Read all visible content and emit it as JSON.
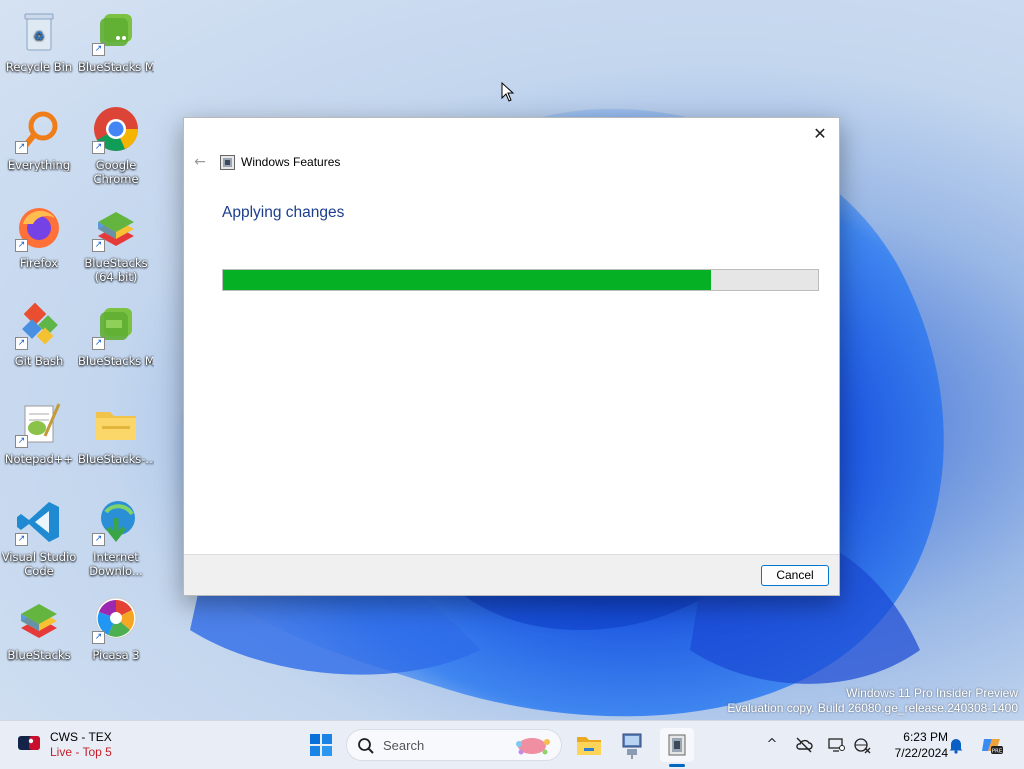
{
  "desktop": {
    "icons": [
      {
        "label": "Recycle Bin",
        "icon": "recycle-bin-icon"
      },
      {
        "label": "BlueStacks Multi-Insta...",
        "icon": "bluestacks-multi-instance-icon"
      },
      {
        "label": "Everything",
        "icon": "everything-search-icon"
      },
      {
        "label": "Google Chrome",
        "icon": "chrome-icon"
      },
      {
        "label": "Firefox",
        "icon": "firefox-icon"
      },
      {
        "label": "BlueStacks (64-bit)",
        "icon": "bluestacks-icon"
      },
      {
        "label": "Git Bash",
        "icon": "git-bash-icon"
      },
      {
        "label": "BlueStacks Multi-Insta...",
        "icon": "bluestacks-multi-instance-icon"
      },
      {
        "label": "Notepad++",
        "icon": "notepadpp-icon"
      },
      {
        "label": "BlueStacks-...",
        "icon": "folder-icon"
      },
      {
        "label": "Visual Studio Code",
        "icon": "vscode-icon"
      },
      {
        "label": "Internet Downlo...",
        "icon": "idm-icon"
      },
      {
        "label": "BlueStacks",
        "icon": "bluestacks-icon"
      },
      {
        "label": "Picasa 3",
        "icon": "picasa-icon"
      }
    ]
  },
  "dialog": {
    "title": "Windows Features",
    "heading": "Applying changes",
    "progress_percent": 82,
    "cancel_label": "Cancel",
    "close_glyph": "✕",
    "back_glyph": "←",
    "progress_color": "#06b025"
  },
  "watermark": {
    "line1": "Windows 11 Pro Insider Preview",
    "line2": "Evaluation copy. Build 26080.ge_release.240308-1400"
  },
  "taskbar": {
    "weather_line1": "CWS - TEX",
    "weather_line2": "Live - Top 5",
    "search_placeholder": "Search",
    "time": "6:23 PM",
    "date": "7/22/2024",
    "tray_overflow_glyph": "^"
  }
}
